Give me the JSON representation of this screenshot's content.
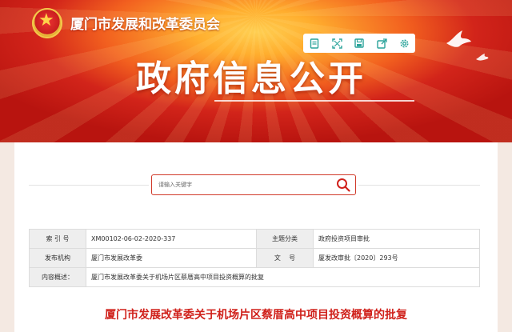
{
  "header": {
    "org_name": "厦门市发展和改革委员会",
    "hero_title": "政府信息公开",
    "toolbar": [
      {
        "icon": "document-icon"
      },
      {
        "icon": "expand-icon"
      },
      {
        "icon": "save-icon"
      },
      {
        "icon": "share-icon"
      },
      {
        "icon": "gear-icon"
      }
    ]
  },
  "search": {
    "placeholder": "请输入关键字"
  },
  "meta": {
    "index_label": "索 引 号",
    "index_value": "XM00102-06-02-2020-337",
    "topic_label": "主题分类",
    "topic_value": "政府投资项目审批",
    "issuer_label": "发布机构",
    "issuer_value": "厦门市发展改革委",
    "docno_label": "文    号",
    "docno_value": "厦发改审批〔2020〕293号",
    "summary_label": "内容概述：",
    "summary_value": "厦门市发展改革委关于机场片区蔡厝高中项目投资概算的批复"
  },
  "document": {
    "title": "厦门市发展改革委关于机场片区蔡厝高中项目投资概算的批复"
  },
  "colors": {
    "accent": "#d0211b",
    "teal_icon": "#2aa39a"
  }
}
